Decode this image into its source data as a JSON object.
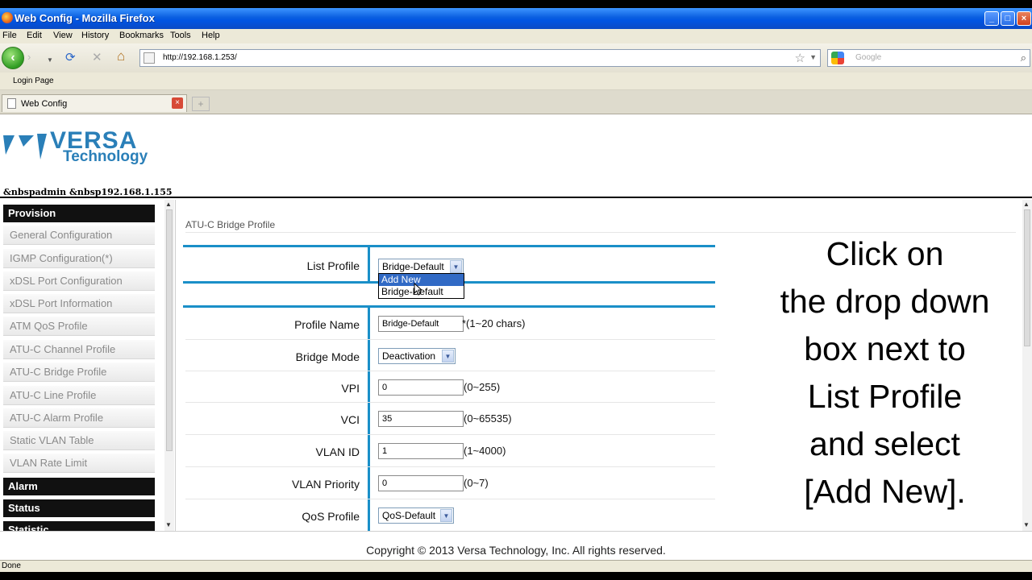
{
  "window": {
    "title": "Web Config - Mozilla Firefox",
    "controls": {
      "minimize": "_",
      "maximize": "□",
      "close": "×"
    }
  },
  "menu": [
    "File",
    "Edit",
    "View",
    "History",
    "Bookmarks",
    "Tools",
    "Help"
  ],
  "nav": {
    "url": "http://192.168.1.253/",
    "search_placeholder": "Google",
    "back_glyph": "‹",
    "forward_glyph": "›",
    "reload_glyph": "⟳",
    "stop_glyph": "✕",
    "home_glyph": "⌂",
    "star_glyph": "☆",
    "drop_glyph": "▼",
    "search_glyph": "⌕"
  },
  "bookmarks": [
    "Login Page"
  ],
  "tab": {
    "label": "Web Config",
    "close_glyph": "×",
    "new_tab_glyph": "+"
  },
  "header": {
    "brand_main": "VERSA",
    "brand_sub": "Technology",
    "user_line": "&nbspadmin   &nbsp192.168.1.155"
  },
  "sidebar": {
    "sections": [
      "Provision",
      "Alarm",
      "Status",
      "Statistic"
    ],
    "items": [
      "General Configuration",
      "IGMP Configuration(*)",
      "xDSL Port Configuration",
      "xDSL Port Information",
      "ATM QoS Profile",
      "ATU-C Channel Profile",
      "ATU-C Bridge Profile",
      "ATU-C Line Profile",
      "ATU-C Alarm Profile",
      "Static VLAN Table",
      "VLAN Rate Limit"
    ]
  },
  "content": {
    "section_title": "ATU-C Bridge Profile",
    "list_profile": {
      "label": "List Profile",
      "value": "Bridge-Default",
      "options": [
        "Add New",
        "Bridge-Default"
      ]
    },
    "fields": [
      {
        "label": "Profile Name",
        "type": "input",
        "value": "Bridge-Default",
        "hint": "*(1~20 chars)"
      },
      {
        "label": "Bridge Mode",
        "type": "select",
        "value": "Deactivation",
        "hint": ""
      },
      {
        "label": "VPI",
        "type": "input",
        "value": "0",
        "hint": "(0~255)"
      },
      {
        "label": "VCI",
        "type": "input",
        "value": "35",
        "hint": "(0~65535)"
      },
      {
        "label": "VLAN ID",
        "type": "input",
        "value": "1",
        "hint": "(1~4000)"
      },
      {
        "label": "VLAN Priority",
        "type": "input",
        "value": "0",
        "hint": "(0~7)"
      },
      {
        "label": "QoS Profile",
        "type": "select",
        "value": "QoS-Default",
        "hint": ""
      }
    ]
  },
  "instruction": [
    "Click on",
    "the drop down",
    "box next to",
    "List Profile",
    "and select",
    "[Add New]."
  ],
  "footer": {
    "copyright": "Copyright © 2013 Versa Technology, Inc. All rights reserved."
  },
  "status": {
    "text": "Done"
  },
  "colors": {
    "accent_blue": "#1a8fc8",
    "logo_blue": "#2a7fb8",
    "highlight": "#316ac5"
  }
}
